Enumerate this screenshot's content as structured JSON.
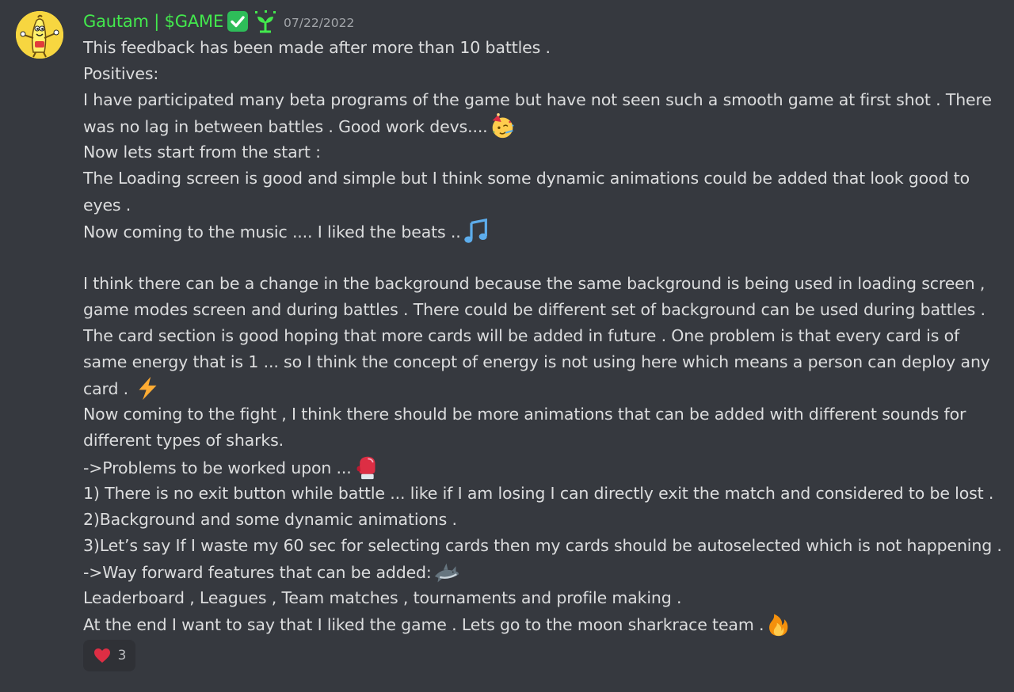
{
  "author": {
    "name": "Gautam | $GAME",
    "avatar_icon": "banana-character-avatar-icon",
    "badge_icons": [
      "check-mark-icon",
      "sprout-icon"
    ]
  },
  "timestamp": "07/22/2022",
  "message_lines": [
    {
      "text": "This feedback has been made after more than 10 battles ."
    },
    {
      "text": "Positives:"
    },
    {
      "text": "I have participated many beta programs of the game but have not seen such a smooth game at first shot . There"
    },
    {
      "text": "was no lag in between battles . Good work devs....",
      "emoji": "party-face-emoji"
    },
    {
      "text": "Now lets start from the start :"
    },
    {
      "text": "The Loading screen is good and simple but I think some dynamic animations could be added that look good to"
    },
    {
      "text": "eyes ."
    },
    {
      "text": "Now coming to the music .... I liked the beats ..",
      "emoji": "music-note-emoji"
    },
    {
      "text": ""
    },
    {
      "text": "I think there can be a change in the background because the same background is being used in loading screen ,"
    },
    {
      "text": "game modes screen and during battles . There could be different set of background can be used during battles ."
    },
    {
      "text": "The card section is good hoping that more cards will be added in future . One problem is that every card is of"
    },
    {
      "text": "same energy that is 1 ... so I think the concept of energy is not using here which means a person can deploy any"
    },
    {
      "text": "card . ",
      "emoji": "lightning-bolt-emoji"
    },
    {
      "text": "Now coming to the fight , I think there should be more animations that can be added with different sounds for"
    },
    {
      "text": "different types of sharks."
    },
    {
      "text": "->Problems to be worked upon ...",
      "emoji": "boxing-glove-emoji"
    },
    {
      "text": "1) There is no exit button while battle ... like if I am losing I can directly exit the match and considered to be lost ."
    },
    {
      "text": "2)Background and some dynamic animations ."
    },
    {
      "text": "3)Let’s say If I waste my 60 sec for selecting cards then my cards should be autoselected which is not happening ."
    },
    {
      "text": "->Way forward features that can be added:",
      "emoji": "shark-emoji"
    },
    {
      "text": "Leaderboard , Leagues  , Team matches , tournaments and profile making ."
    },
    {
      "text": "At the end I want to say that I liked the game . Lets go to the moon sharkrace team .",
      "emoji": "fire-emoji"
    }
  ],
  "reaction": {
    "icon": "heart-icon",
    "count": "3"
  },
  "colors": {
    "background": "#36393f",
    "username": "#43e94d",
    "text": "#dcddde",
    "timestamp": "#a3a6aa",
    "reaction_bg": "#2f3136"
  }
}
